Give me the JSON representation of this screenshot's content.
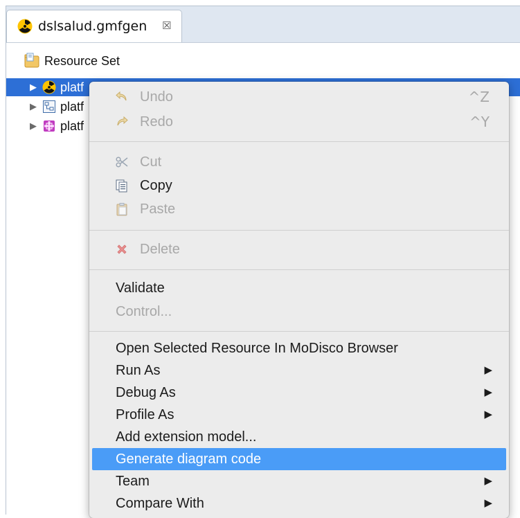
{
  "tab": {
    "title": "dslsalud.gmfgen",
    "close_glyph": "☒",
    "icon": "radiation-icon"
  },
  "tree": {
    "root_label": "Resource Set",
    "items": [
      {
        "label": "platf",
        "icon": "radiation-icon",
        "selected": true
      },
      {
        "label": "platf",
        "icon": "model-icon",
        "selected": false
      },
      {
        "label": "platf",
        "icon": "ecore-icon",
        "selected": false
      }
    ]
  },
  "context_menu": {
    "undo": {
      "label": "Undo",
      "shortcut": "^Z",
      "enabled": false
    },
    "redo": {
      "label": "Redo",
      "shortcut": "^Y",
      "enabled": false
    },
    "cut": {
      "label": "Cut",
      "enabled": false
    },
    "copy": {
      "label": "Copy",
      "enabled": true
    },
    "paste": {
      "label": "Paste",
      "enabled": false
    },
    "delete": {
      "label": "Delete",
      "enabled": false
    },
    "validate": {
      "label": "Validate",
      "enabled": true
    },
    "control": {
      "label": "Control...",
      "enabled": false
    },
    "open_modisco": {
      "label": "Open Selected Resource In MoDisco Browser"
    },
    "run_as": {
      "label": "Run As",
      "submenu": true
    },
    "debug_as": {
      "label": "Debug As",
      "submenu": true
    },
    "profile_as": {
      "label": "Profile As",
      "submenu": true
    },
    "add_extension": {
      "label": "Add extension model..."
    },
    "generate_diagram": {
      "label": "Generate diagram code",
      "highlighted": true
    },
    "team": {
      "label": "Team",
      "submenu": true
    },
    "compare_with": {
      "label": "Compare With",
      "submenu": true
    }
  },
  "glyphs": {
    "submenu_arrow": "▶",
    "tree_arrow": "▶"
  },
  "colors": {
    "selection": "#2d6fd6",
    "menu_highlight": "#4a9cf7",
    "menu_background": "#ececec",
    "disabled_text": "#a8a8a8"
  }
}
